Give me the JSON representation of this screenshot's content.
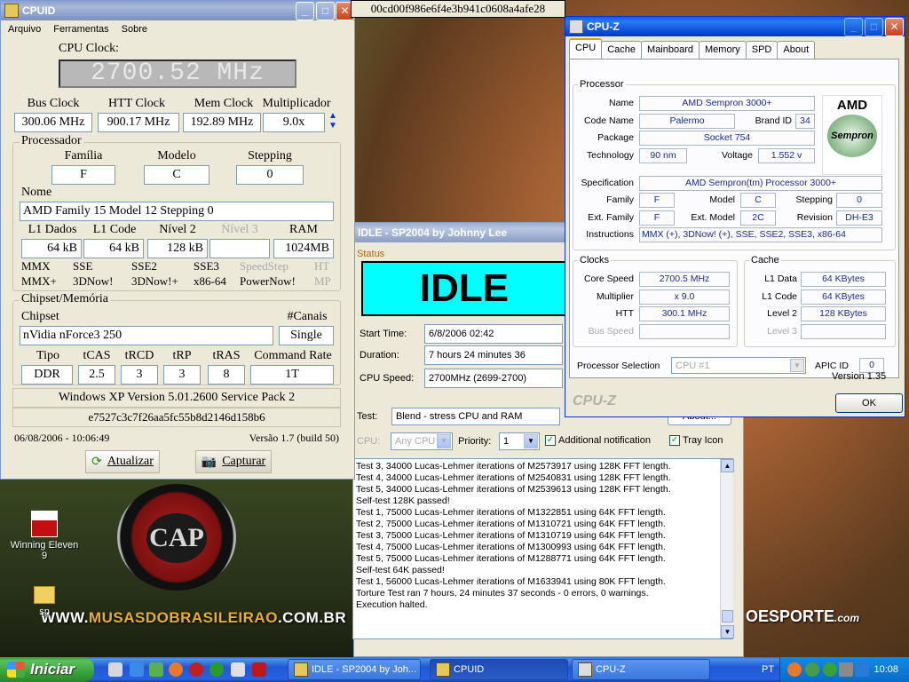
{
  "desktop": {
    "site_pre": "WWW.",
    "site_mid": "MUSASDOBRASILEIRAO",
    "site_post": ".COM.BR",
    "crest_text": "CAP",
    "esporte_main": "OESPORTE",
    "esporte_dom": ".com",
    "icons": [
      {
        "label": "Winning Eleven 9"
      },
      {
        "label": "sp"
      }
    ]
  },
  "hash": "00cd00f986e6f4e3b941c0608a4afe28",
  "cpuid": {
    "title": "CPUID",
    "menu": [
      "Arquivo",
      "Ferramentas",
      "Sobre"
    ],
    "cpu_clock_label": "CPU Clock:",
    "cpu_clock_value": "2700.52 MHz",
    "bus_label": "Bus Clock",
    "bus_value": "300.06 MHz",
    "htt_label": "HTT Clock",
    "htt_value": "900.17 MHz",
    "mem_label": "Mem Clock",
    "mem_value": "192.89 MHz",
    "mult_label": "Multiplicador",
    "mult_value": "9.0x",
    "proc_group": "Processador",
    "familia_label": "Família",
    "familia_value": "F",
    "modelo_label": "Modelo",
    "modelo_value": "C",
    "stepping_label": "Stepping",
    "stepping_value": "0",
    "nome_label": "Nome",
    "nome_value": "AMD Family 15 Model 12 Stepping 0",
    "l1d_label": "L1 Dados",
    "l1d_value": "64 kB",
    "l1c_label": "L1 Code",
    "l1c_value": "64 kB",
    "l2_label": "Nível 2",
    "l2_value": "128 kB",
    "l3_label": "Nível 3",
    "l3_value": "",
    "ram_label": "RAM",
    "ram_value": "1024MB",
    "features_row1": [
      "MMX",
      "SSE",
      "SSE2",
      "SSE3",
      "SpeedStep",
      "HT"
    ],
    "features_row2": [
      "MMX+",
      "3DNow!",
      "3DNow!+",
      "x86-64",
      "PowerNow!",
      "MP"
    ],
    "chipset_group": "Chipset/Memória",
    "chipset_label": "Chipset",
    "chipset_value": "nVidia nForce3 250",
    "canais_label": "#Canais",
    "canais_value": "Single",
    "tipo_label": "Tipo",
    "tipo_value": "DDR",
    "tcas_label": "tCAS",
    "tcas_value": "2.5",
    "trcd_label": "tRCD",
    "trcd_value": "3",
    "trp_label": "tRP",
    "trp_value": "3",
    "tras_label": "tRAS",
    "tras_value": "8",
    "cmd_label": "Command Rate",
    "cmd_value": "1T",
    "os": "Windows XP Version 5.01.2600 Service Pack 2",
    "hash": "e7527c3c7f26aa5fc55b8d2146d158b6",
    "datetime": "06/08/2006 - 10:06:49",
    "version": "Versão 1.7 (build 50)",
    "btn_update": "Atualizar",
    "btn_capture": "Capturar"
  },
  "prime": {
    "title": "IDLE - SP2004 by Johnny Lee",
    "status_label": "Status",
    "status_big": "IDLE",
    "start_label": "Start Time:",
    "start_value": "6/8/2006 02:42",
    "duration_label": "Duration:",
    "duration_value": "7 hours 24 minutes 36 seconds",
    "speed_label": "CPU Speed:",
    "speed_value": "2700MHz (2699-2700)",
    "test_label": "Test:",
    "test_value": "Blend - stress CPU and RAM",
    "cpu_label": "CPU:",
    "cpu_value": "Any CPU",
    "priority_label": "Priority:",
    "priority_value": "1",
    "notif_label": "Additional notification",
    "tray_label": "Tray Icon",
    "about_btn": "About...",
    "log": [
      "Test 3, 34000 Lucas-Lehmer iterations of M2573917 using 128K FFT length.",
      "Test 4, 34000 Lucas-Lehmer iterations of M2540831 using 128K FFT length.",
      "Test 5, 34000 Lucas-Lehmer iterations of M2539613 using 128K FFT length.",
      "Self-test 128K passed!",
      "Test 1, 75000 Lucas-Lehmer iterations of M1322851 using 64K FFT length.",
      "Test 2, 75000 Lucas-Lehmer iterations of M1310721 using 64K FFT length.",
      "Test 3, 75000 Lucas-Lehmer iterations of M1310719 using 64K FFT length.",
      "Test 4, 75000 Lucas-Lehmer iterations of M1300993 using 64K FFT length.",
      "Test 5, 75000 Lucas-Lehmer iterations of M1288771 using 64K FFT length.",
      "Self-test 64K passed!",
      "Test 1, 56000 Lucas-Lehmer iterations of M1633941 using 80K FFT length.",
      "Torture Test ran 7 hours, 24 minutes 37 seconds - 0 errors, 0 warnings.",
      "Execution halted."
    ]
  },
  "cpuz": {
    "title": "CPU-Z",
    "tabs": [
      "CPU",
      "Cache",
      "Mainboard",
      "Memory",
      "SPD",
      "About"
    ],
    "processor_group": "Processor",
    "name_label": "Name",
    "name_value": "AMD Sempron 3000+",
    "codename_label": "Code Name",
    "codename_value": "Palermo",
    "brandid_label": "Brand ID",
    "brandid_value": "34",
    "package_label": "Package",
    "package_value": "Socket 754",
    "tech_label": "Technology",
    "tech_value": "90 nm",
    "voltage_label": "Voltage",
    "voltage_value": "1.552 v",
    "spec_label": "Specification",
    "spec_value": "AMD Sempron(tm) Processor 3000+",
    "family_label": "Family",
    "family_value": "F",
    "model_label": "Model",
    "model_value": "C",
    "stepping_label": "Stepping",
    "stepping_value": "0",
    "extfamily_label": "Ext. Family",
    "extfamily_value": "F",
    "extmodel_label": "Ext. Model",
    "extmodel_value": "2C",
    "revision_label": "Revision",
    "revision_value": "DH-E3",
    "instr_label": "Instructions",
    "instr_value": "MMX (+), 3DNow! (+), SSE, SSE2, SSE3, x86-64",
    "clocks_group": "Clocks",
    "core_label": "Core Speed",
    "core_value": "2700.5 MHz",
    "mult_label": "Multiplier",
    "mult_value": "x 9.0",
    "htt_label": "HTT",
    "htt_value": "300.1 MHz",
    "bus_label": "Bus Speed",
    "bus_value": "",
    "cache_group": "Cache",
    "l1d_label": "L1 Data",
    "l1d_value": "64 KBytes",
    "l1c_label": "L1 Code",
    "l1c_value": "64 KBytes",
    "l2_label": "Level 2",
    "l2_value": "128 KBytes",
    "l3_label": "Level 3",
    "l3_value": "",
    "procsel_label": "Processor Selection",
    "procsel_value": "CPU #1",
    "apic_label": "APIC ID",
    "apic_value": "0",
    "version": "Version 1.35",
    "brand": "CPU-Z",
    "ok": "OK",
    "logo_amd": "AMD",
    "logo_sempron": "Sempron"
  },
  "taskbar": {
    "start": "Iniciar",
    "tasks": [
      "IDLE - SP2004 by Joh...",
      "CPUID",
      "CPU-Z"
    ],
    "lang": "PT",
    "clock": "10:08"
  }
}
